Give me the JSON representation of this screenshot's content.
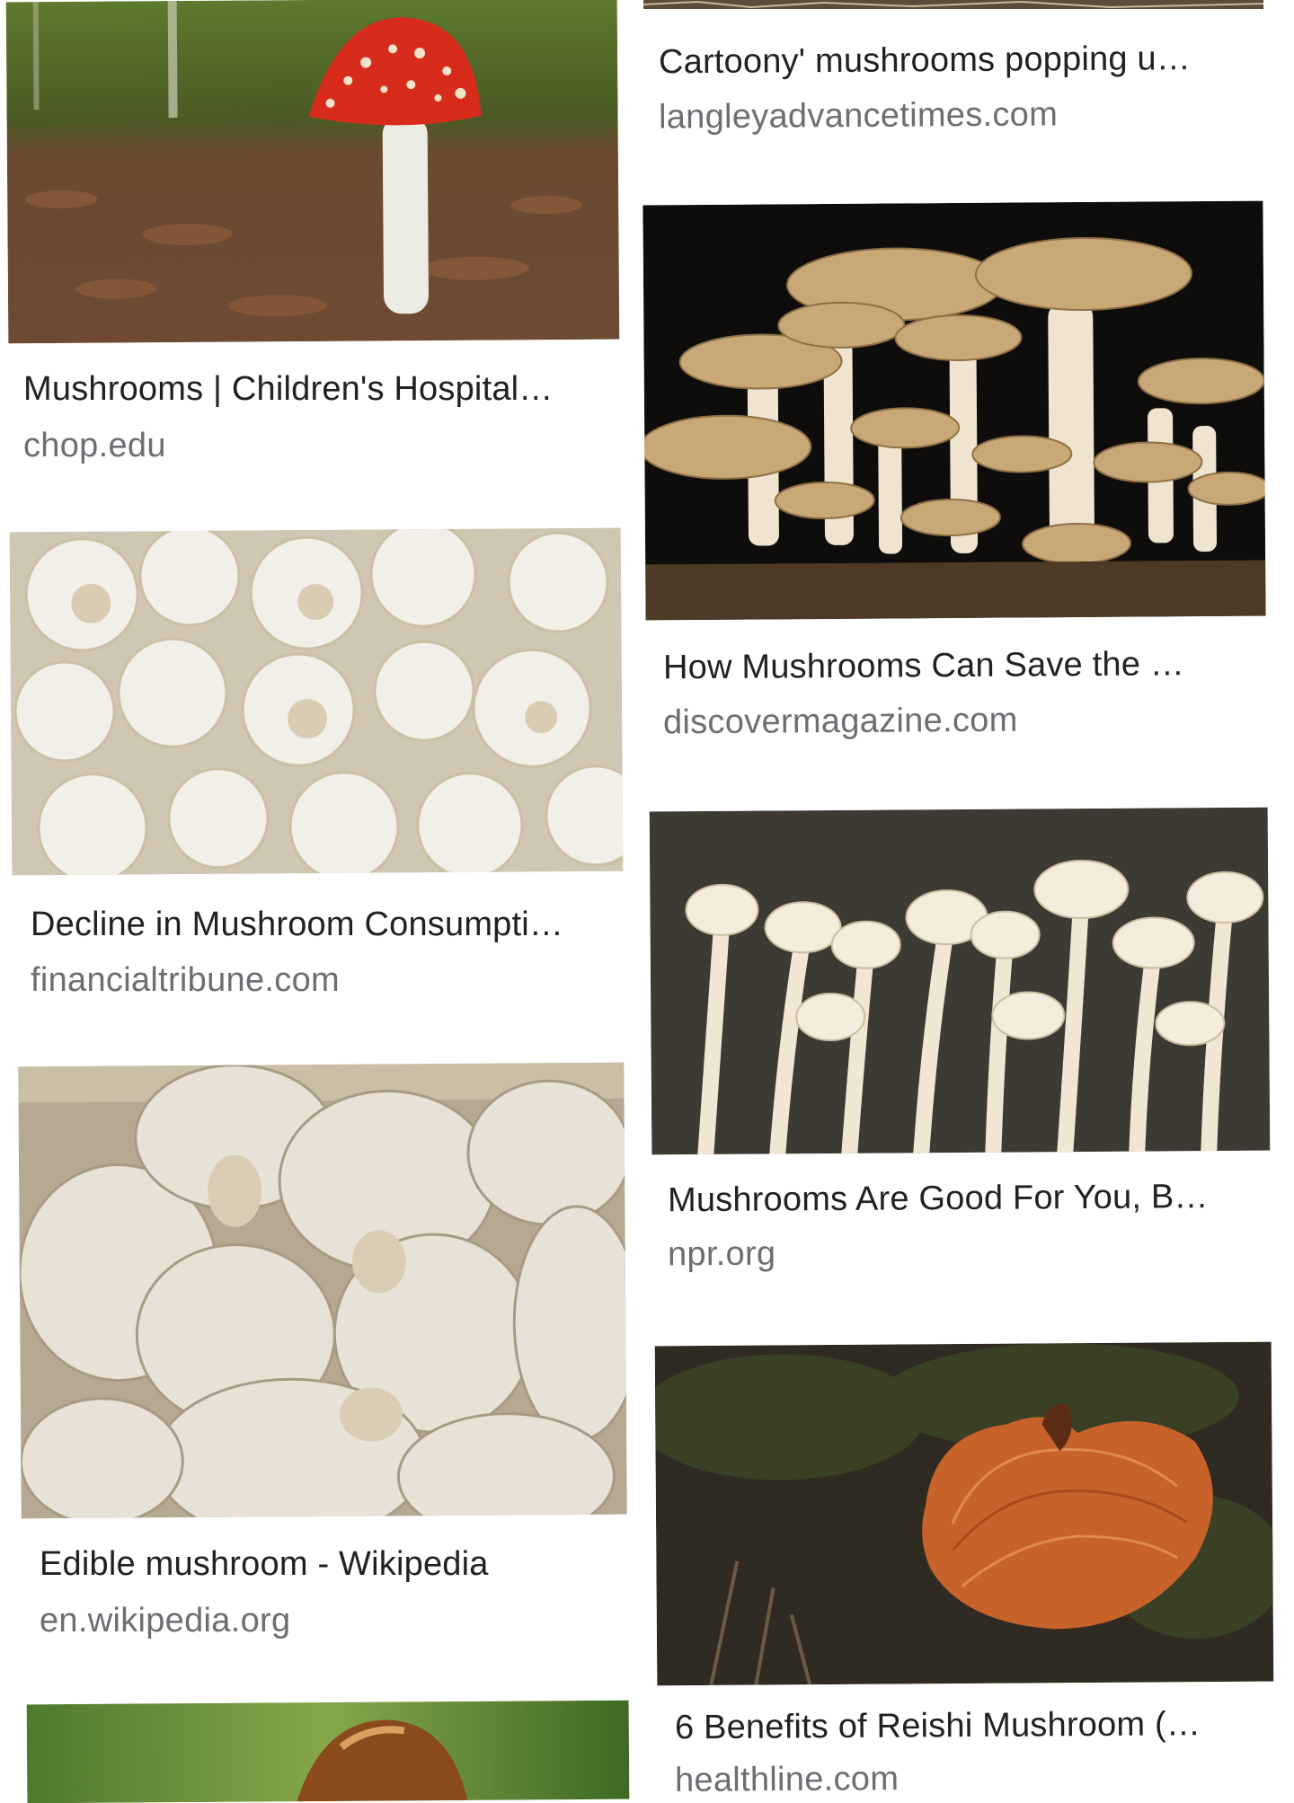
{
  "results": [
    {
      "title": "Mushrooms | Children's Hospital…",
      "source": "chop.edu",
      "image": "red-fly-agaric-mushroom-image"
    },
    {
      "title": "Decline in Mushroom Consumpti…",
      "source": "financialtribune.com",
      "image": "white-button-mushrooms-image"
    },
    {
      "title": "Edible mushroom - Wikipedia",
      "source": "en.wikipedia.org",
      "image": "edible-mushrooms-closeup-image"
    },
    {
      "title": "Cartoony' mushrooms popping u…",
      "source": "langleyadvancetimes.com",
      "image": "mushrooms-image"
    },
    {
      "title": "How Mushrooms Can Save the …",
      "source": "discovermagazine.com",
      "image": "mushroom-cluster-image"
    },
    {
      "title": "Mushrooms Are Good For You, B…",
      "source": "npr.org",
      "image": "enoki-mushrooms-image"
    },
    {
      "title": "6 Benefits of Reishi Mushroom (…",
      "source": "healthline.com",
      "image": "reishi-mushroom-image"
    },
    {
      "title": "",
      "source": "",
      "image": "brown-cap-mushroom-image"
    }
  ],
  "colors": {
    "title_text": "#202124",
    "source_text": "#6b6e72",
    "background": "#ffffff"
  }
}
